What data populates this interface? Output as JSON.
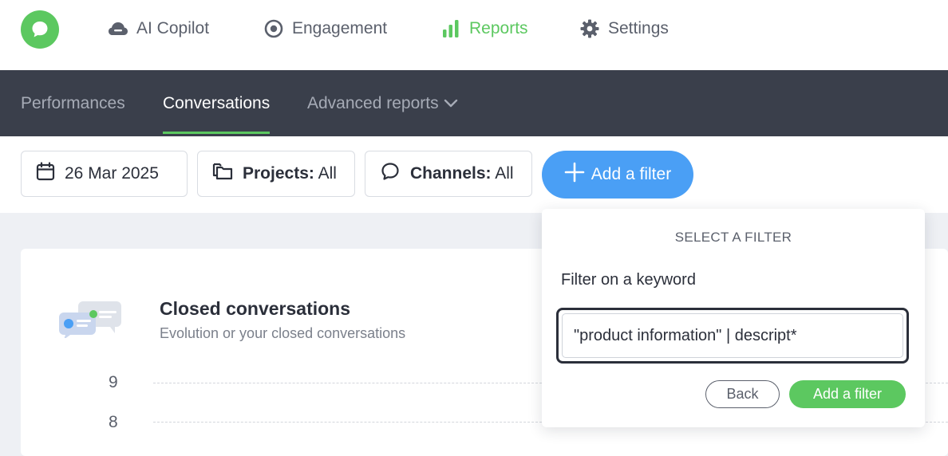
{
  "top_nav": {
    "items": [
      {
        "label": "AI Copilot",
        "icon": "cloud-icon"
      },
      {
        "label": "Engagement",
        "icon": "target-icon"
      },
      {
        "label": "Reports",
        "icon": "bar-chart-icon",
        "active": true
      },
      {
        "label": "Settings",
        "icon": "gear-icon"
      }
    ]
  },
  "sub_nav": {
    "tabs": [
      {
        "label": "Performances"
      },
      {
        "label": "Conversations",
        "active": true
      },
      {
        "label": "Advanced reports"
      }
    ]
  },
  "filters": {
    "date": "26 Mar 2025",
    "projects_label": "Projects:",
    "projects_value": "All",
    "channels_label": "Channels:",
    "channels_value": "All",
    "add_filter": "Add a filter"
  },
  "card": {
    "title": "Closed conversations",
    "subtitle": "Evolution or your closed conversations",
    "y_ticks": [
      "9",
      "8"
    ]
  },
  "dropdown": {
    "heading": "SELECT A FILTER",
    "label": "Filter on a keyword",
    "input_value": "\"product information\" | descript*",
    "back": "Back",
    "add": "Add a filter"
  },
  "colors": {
    "accent_green": "#5cc860",
    "accent_blue": "#4a9ff5",
    "dark_nav": "#3a3f4b"
  }
}
